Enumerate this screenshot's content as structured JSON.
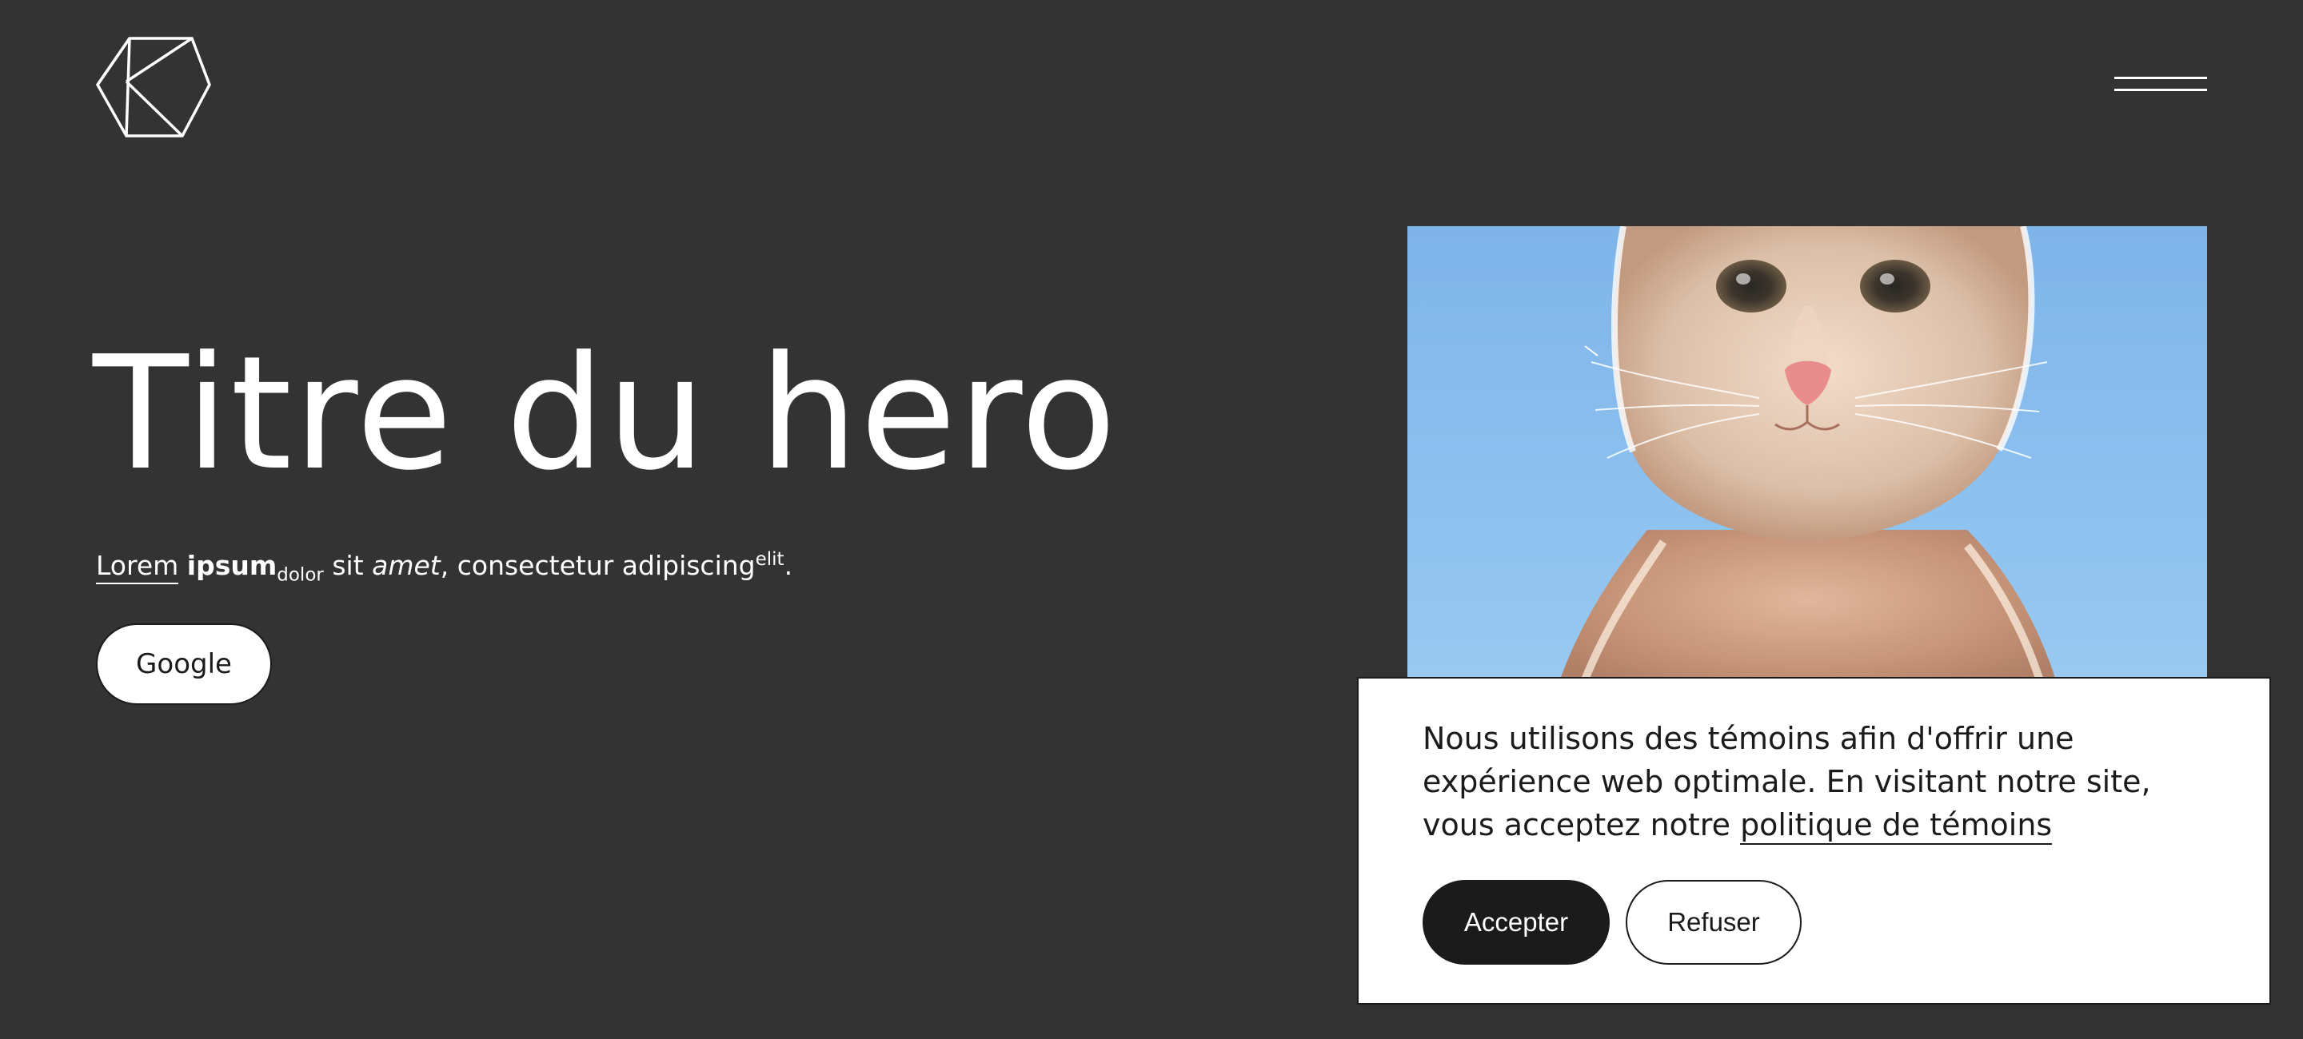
{
  "header": {
    "logo_icon": "hexagon-k-logo-icon",
    "menu_icon": "hamburger-menu-icon"
  },
  "hero": {
    "title": "Titre du hero",
    "text": {
      "lorem": "Lorem",
      "ipsum": "ipsum",
      "dolor": "dolor",
      "sit": " sit ",
      "amet": "amet",
      "rest": ", consectetur adipiscing",
      "elit": "elit",
      "period": "."
    },
    "button_label": "Google",
    "image_icon": "kitten-photo"
  },
  "cookie_banner": {
    "message": "Nous utilisons des témoins afin d'offrir une expérience web optimale. En visitant notre site, vous acceptez notre ",
    "policy_link": "politique de témoins",
    "accept_label": "Accepter",
    "refuse_label": "Refuser"
  },
  "colors": {
    "background": "#333333",
    "foreground": "#ffffff",
    "dark": "#1b1b1b",
    "sky": "#8dc1ef"
  }
}
